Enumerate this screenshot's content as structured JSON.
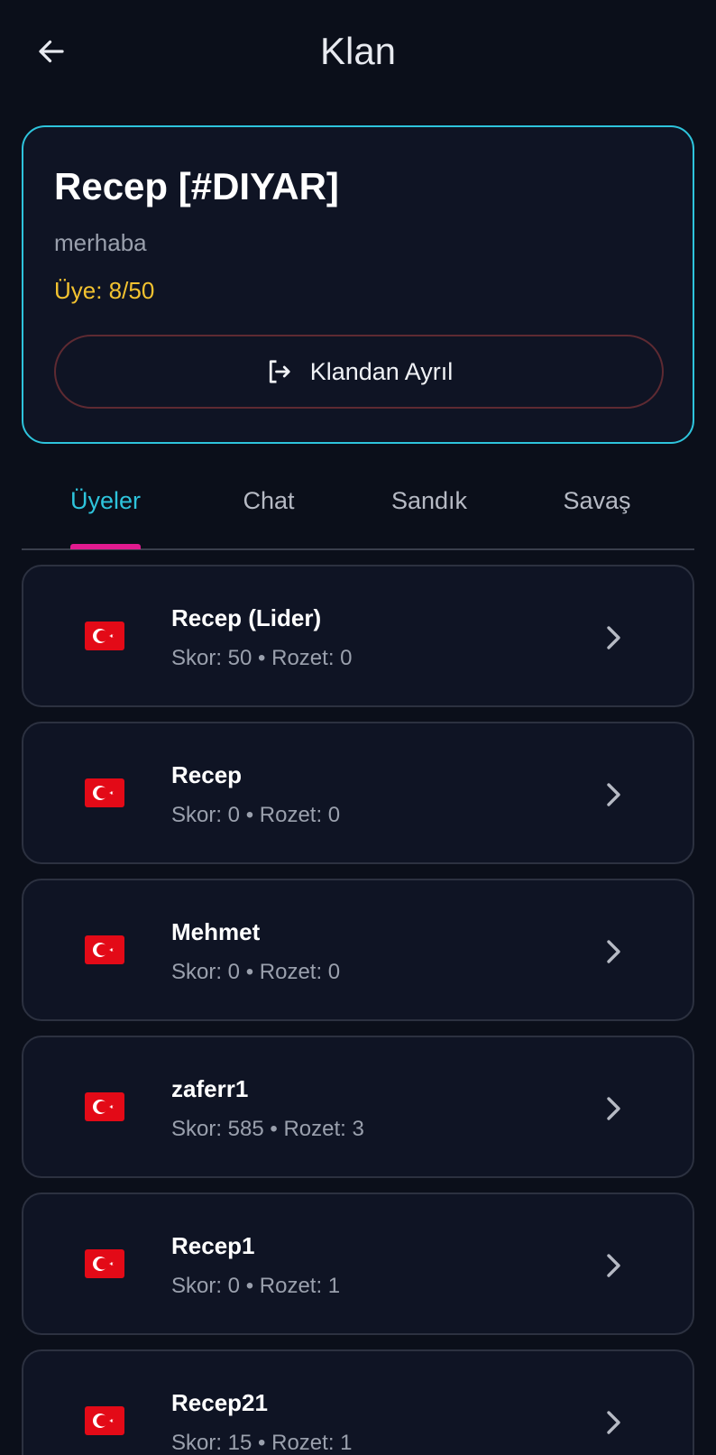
{
  "header": {
    "title": "Klan",
    "back_icon": "arrow-left-icon"
  },
  "clan": {
    "name": "Recep [#DIYAR]",
    "description": "merhaba",
    "members": "Üye: 8/50",
    "leave_label": "Klandan Ayrıl",
    "leave_icon": "logout-icon"
  },
  "tabs": [
    {
      "label": "Üyeler",
      "active": true
    },
    {
      "label": "Chat",
      "active": false
    },
    {
      "label": "Sandık",
      "active": false
    },
    {
      "label": "Savaş",
      "active": false
    }
  ],
  "members": [
    {
      "name": "Recep (Lider)",
      "stats": "Skor: 50 • Rozet: 0",
      "flag": "turkey-flag-icon"
    },
    {
      "name": "Recep",
      "stats": "Skor: 0 • Rozet: 0",
      "flag": "turkey-flag-icon"
    },
    {
      "name": "Mehmet",
      "stats": "Skor: 0 • Rozet: 0",
      "flag": "turkey-flag-icon"
    },
    {
      "name": "zaferr1",
      "stats": "Skor: 585 • Rozet: 3",
      "flag": "turkey-flag-icon"
    },
    {
      "name": "Recep1",
      "stats": "Skor: 0 • Rozet: 1",
      "flag": "turkey-flag-icon"
    },
    {
      "name": "Recep21",
      "stats": "Skor: 15 • Rozet: 1",
      "flag": "turkey-flag-icon"
    }
  ],
  "colors": {
    "background": "#0b0f1a",
    "accent": "#2ec4dc",
    "tab_indicator": "#e21a8f",
    "member_count": "#f2c230",
    "leave_border": "#5e2a32"
  }
}
